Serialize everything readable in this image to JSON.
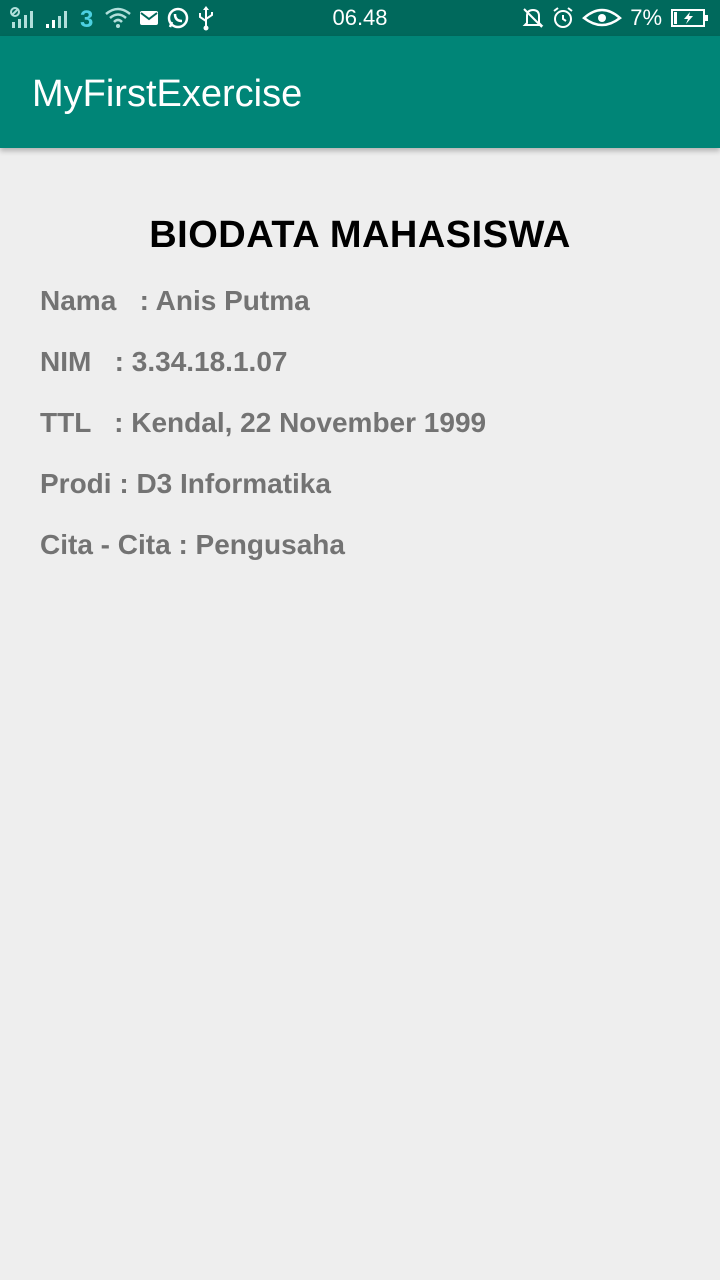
{
  "status_bar": {
    "time": "06.48",
    "battery_percent": "7%",
    "icons_left": [
      "signal-icon",
      "signal-icon",
      "carrier-3-icon",
      "wifi-icon",
      "mail-icon",
      "whatsapp-icon",
      "usb-icon"
    ],
    "icons_right": [
      "notifications-off-icon",
      "alarm-icon",
      "eye-icon",
      "battery-charging-icon"
    ]
  },
  "app_bar": {
    "title": "MyFirstExercise"
  },
  "biodata": {
    "heading": "BIODATA MAHASISWA",
    "rows": [
      "Nama   : Anis Putma",
      "NIM   : 3.34.18.1.07",
      "TTL   : Kendal, 22 November 1999",
      "Prodi : D3 Informatika",
      "Cita - Cita : Pengusaha"
    ]
  },
  "colors": {
    "status_bar": "#00695c",
    "app_bar": "#008577",
    "background": "#eeeeee",
    "body_text": "#737373"
  }
}
